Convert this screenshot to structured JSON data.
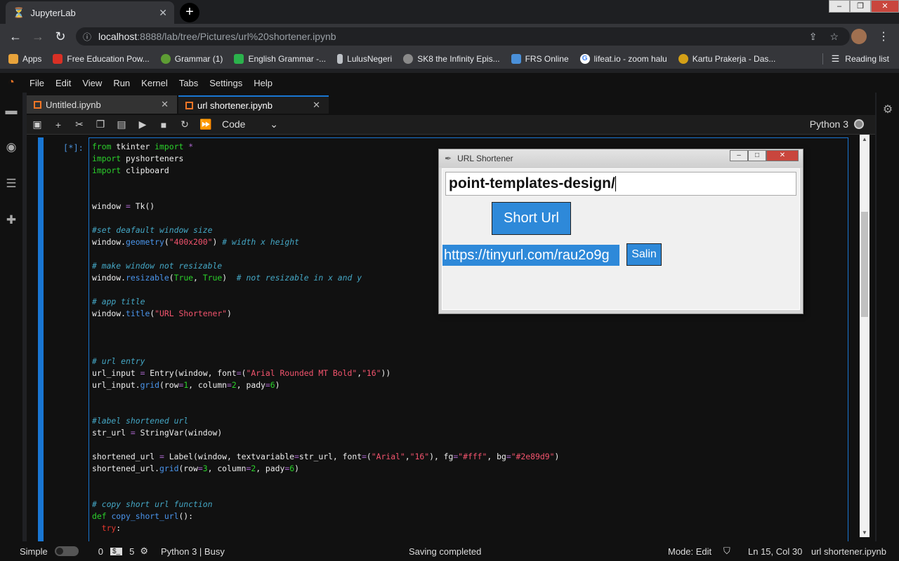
{
  "browser": {
    "tab_title": "JupyterLab",
    "tab_close": "✕",
    "new_tab": "+",
    "window_controls": {
      "minimize": "–",
      "maximize": "❐",
      "close": "✕"
    },
    "url_host": "localhost",
    "url_path": ":8888/lab/tree/Pictures/url%20shortener.ipynb",
    "bookmarks": [
      {
        "label": "Apps",
        "icon": "apps-icon",
        "color": "#e8a33b"
      },
      {
        "label": "Free Education Pow...",
        "icon": "bookmark-favicon",
        "color": "#d93025"
      },
      {
        "label": "Grammar (1)",
        "icon": "bookmark-favicon",
        "color": "#5e9d34"
      },
      {
        "label": "English Grammar -...",
        "icon": "bookmark-favicon",
        "color": "#2bb24c"
      },
      {
        "label": "LulusNegeri",
        "icon": "bookmark-favicon",
        "color": "#bdc1c6"
      },
      {
        "label": "SK8 the Infinity Epis...",
        "icon": "bookmark-favicon",
        "color": "#8a8a8a"
      },
      {
        "label": "FRS Online",
        "icon": "bookmark-favicon",
        "color": "#4a90d9"
      },
      {
        "label": "lifeat.io - zoom halu",
        "icon": "google-icon",
        "color": "#ffffff"
      },
      {
        "label": "Kartu Prakerja - Das...",
        "icon": "bookmark-favicon",
        "color": "#d4a017"
      }
    ],
    "reading_list": "Reading list"
  },
  "jupyter": {
    "menu": [
      "File",
      "Edit",
      "View",
      "Run",
      "Kernel",
      "Tabs",
      "Settings",
      "Help"
    ],
    "tabs": [
      {
        "label": "Untitled.ipynb",
        "close": "✕"
      },
      {
        "label": "url shortener.ipynb",
        "close": "✕"
      }
    ],
    "cell_type": "Code",
    "kernel_name": "Python 3",
    "prompt": "[*]:"
  },
  "tk_window": {
    "title": "URL Shortener",
    "entry_value": "point-templates-design/",
    "short_button": "Short Url",
    "result": "https://tinyurl.com/rau2o9g",
    "copy_button": "Salin"
  },
  "status": {
    "mode_label": "Simple",
    "terminals": "0",
    "kernels": "5",
    "kernel_status": "Python 3 | Busy",
    "message": "Saving completed",
    "edit_mode": "Mode: Edit",
    "cursor": "Ln 15, Col 30",
    "filename": "url shortener.ipynb"
  }
}
